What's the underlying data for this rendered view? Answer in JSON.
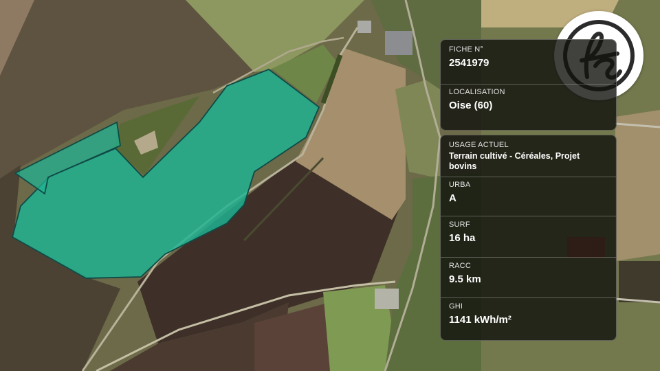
{
  "fiche": {
    "label": "FICHE N°",
    "value": "2541979"
  },
  "localisation": {
    "label": "LOCALISATION",
    "value": "Oise (60)"
  },
  "details": [
    {
      "label": "USAGE ACTUEL",
      "value": "Terrain cultivé - Céréales, Projet bovins"
    },
    {
      "label": "URBA",
      "value": "A"
    },
    {
      "label": "SURF",
      "value": "16 ha"
    },
    {
      "label": "RACC",
      "value": "9.5 km"
    },
    {
      "label": "GHI",
      "value": "1141 kWh/m²"
    }
  ],
  "logo": {
    "text": "fs"
  },
  "colors": {
    "parcel_fill": "#1fb594",
    "parcel_stroke": "#0e4a46",
    "card_bg": "#121210"
  }
}
